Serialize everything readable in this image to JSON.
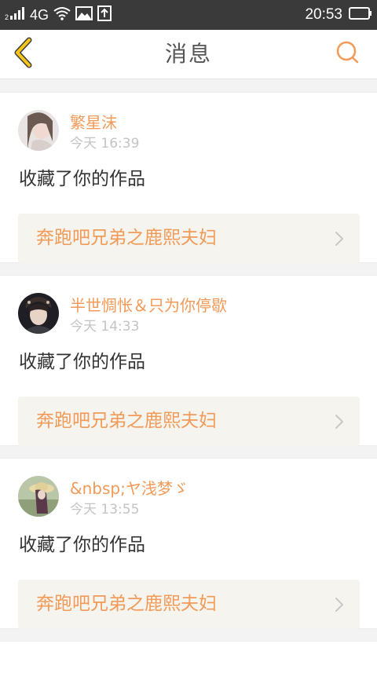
{
  "status_bar": {
    "network": "4G",
    "time": "20:53"
  },
  "header": {
    "title": "消息",
    "back_icon": "chevron-left-icon",
    "search_icon": "search-icon"
  },
  "colors": {
    "accent": "#f29a58",
    "back_arrow": "#f5c518",
    "text_dark": "#333333",
    "text_muted": "#c4c4c4",
    "card_link_bg": "#f5f4ee"
  },
  "messages": [
    {
      "user_name": "繁星沫",
      "time": "今天 16:39",
      "action": "收藏了你的作品",
      "work_title": "奔跑吧兄弟之鹿熙夫妇"
    },
    {
      "user_name": "半世惆怅＆只为你停歇",
      "time": "今天 14:33",
      "action": "收藏了你的作品",
      "work_title": "奔跑吧兄弟之鹿熙夫妇"
    },
    {
      "user_name": "&nbsp;ヤ浅梦ゞ",
      "time": "今天 13:55",
      "action": "收藏了你的作品",
      "work_title": "奔跑吧兄弟之鹿熙夫妇"
    }
  ]
}
